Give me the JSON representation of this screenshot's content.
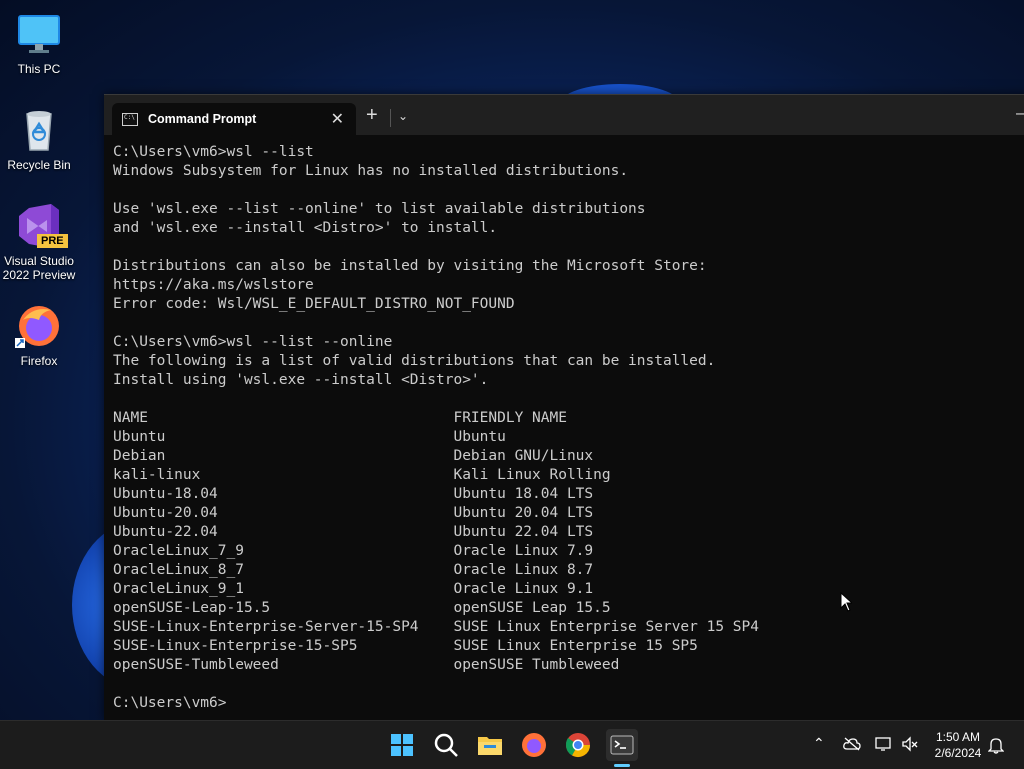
{
  "desktop": {
    "icons": [
      {
        "label": "This PC",
        "icon": "monitor-icon"
      },
      {
        "label": "Recycle Bin",
        "icon": "recycle-bin-icon"
      },
      {
        "label": "Visual Studio\n2022 Preview",
        "icon": "visual-studio-icon",
        "badge": "PRE"
      },
      {
        "label": "Firefox",
        "icon": "firefox-icon"
      }
    ]
  },
  "window": {
    "tab_title": "Command Prompt",
    "tab_icon": "C:\\",
    "new_tab_label": "+",
    "close_label": "✕",
    "minimize_label": "—"
  },
  "console": {
    "lines": [
      "C:\\Users\\vm6>wsl --list",
      "Windows Subsystem for Linux has no installed distributions.",
      "",
      "Use 'wsl.exe --list --online' to list available distributions",
      "and 'wsl.exe --install <Distro>' to install.",
      "",
      "Distributions can also be installed by visiting the Microsoft Store:",
      "https://aka.ms/wslstore",
      "Error code: Wsl/WSL_E_DEFAULT_DISTRO_NOT_FOUND",
      "",
      "C:\\Users\\vm6>wsl --list --online",
      "The following is a list of valid distributions that can be installed.",
      "Install using 'wsl.exe --install <Distro>'.",
      "",
      "NAME                                   FRIENDLY NAME",
      "Ubuntu                                 Ubuntu",
      "Debian                                 Debian GNU/Linux",
      "kali-linux                             Kali Linux Rolling",
      "Ubuntu-18.04                           Ubuntu 18.04 LTS",
      "Ubuntu-20.04                           Ubuntu 20.04 LTS",
      "Ubuntu-22.04                           Ubuntu 22.04 LTS",
      "OracleLinux_7_9                        Oracle Linux 7.9",
      "OracleLinux_8_7                        Oracle Linux 8.7",
      "OracleLinux_9_1                        Oracle Linux 9.1",
      "openSUSE-Leap-15.5                     openSUSE Leap 15.5",
      "SUSE-Linux-Enterprise-Server-15-SP4    SUSE Linux Enterprise Server 15 SP4",
      "SUSE-Linux-Enterprise-15-SP5           SUSE Linux Enterprise 15 SP5",
      "openSUSE-Tumbleweed                    openSUSE Tumbleweed",
      "",
      "C:\\Users\\vm6>"
    ]
  },
  "taskbar": {
    "items": [
      "start-icon",
      "search-icon",
      "file-explorer-icon",
      "firefox-icon",
      "chrome-icon",
      "terminal-icon"
    ],
    "clock_time": "1:50 AM",
    "clock_date": "2/6/2024",
    "tray": [
      "chevron-up-icon",
      "cloud-offline-icon",
      "network-icon",
      "volume-muted-icon",
      "notification-bell-icon"
    ]
  }
}
